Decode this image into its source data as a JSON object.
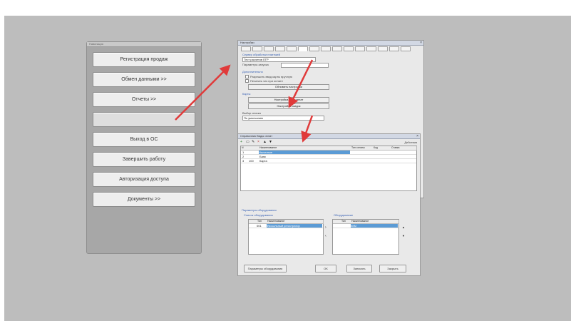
{
  "colors": {
    "desktop": "#bdbdbd",
    "arrow": "#e03a3a",
    "selection": "#5b9bd5"
  },
  "menu": {
    "title": "Навигация",
    "items": [
      {
        "label": "Регистрация продаж"
      },
      {
        "label": "Обмен данными >>"
      },
      {
        "label": "Отчеты >>"
      },
      {
        "label": ""
      },
      {
        "label": "Выход в ОС"
      },
      {
        "label": "Завершить работу"
      },
      {
        "label": "Авторизация доступа"
      },
      {
        "label": "Документы >>"
      }
    ]
  },
  "settings": {
    "title": "Настройки",
    "field1_label": "Сервер обработки платежей",
    "field1_value": "Тест расчетов ЕГР",
    "field2_label": "Параметры запуска",
    "section_title": "Дополнительно",
    "check1": "Разрешить ввод карты вручную",
    "check2": "Печатать чек при оплате",
    "button1": "Обновить настройки",
    "section2_title": "Карты",
    "button2": "Настройка карт оплат",
    "button3": "Настройка скидок",
    "field3_label": "Выбор списка",
    "field3_value": "По умолчанию"
  },
  "table_dialog": {
    "title": "Справочник Виды оплат",
    "toolbar_right": "Действия",
    "columns": [
      "N",
      "",
      "Наименование",
      "Тип оплаты",
      "Код",
      "Ставка"
    ],
    "rows": [
      {
        "n": "1",
        "code": "",
        "name": "Наличные",
        "selected": true
      },
      {
        "n": "2",
        "code": "",
        "name": "Банк",
        "selected": false
      },
      {
        "n": "3",
        "code": "100",
        "name": "Карта",
        "selected": false
      }
    ],
    "bottom_section": "Параметры оборудования",
    "left_list_title": "Список оборудования",
    "right_list_title": "Оборудование",
    "left_list_columns": [
      "Тип",
      "Наименование"
    ],
    "left_list_rows": [
      {
        "code": "001",
        "name": "Фискальный регистратор"
      }
    ],
    "right_list_columns": [
      "Тип",
      "Наименование"
    ],
    "right_list_rows": [
      {
        "code": "",
        "name": "ККМ"
      }
    ],
    "buttons": [
      "Параметры оборудования",
      "OK",
      "Записать",
      "Закрыть"
    ]
  }
}
